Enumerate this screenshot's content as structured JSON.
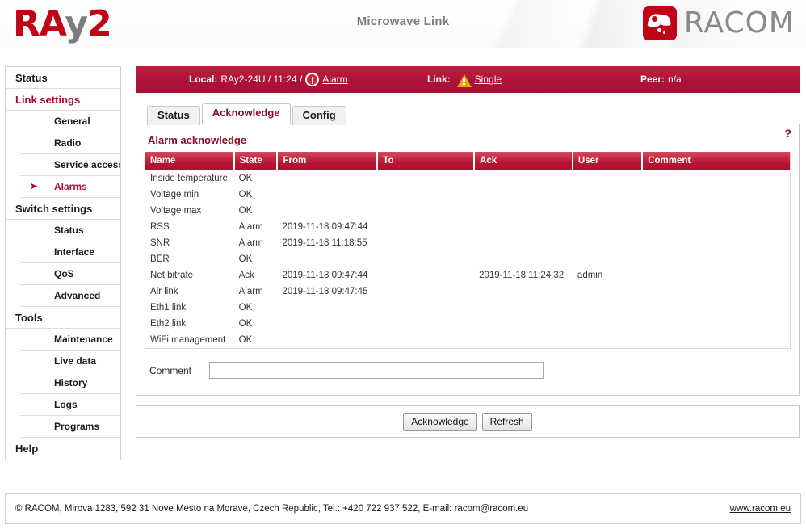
{
  "header": {
    "logo_text_red_1": "RA",
    "logo_text_grey": "y",
    "logo_text_red_2": "2",
    "title": "Microwave Link",
    "brand": "RACOM"
  },
  "statusbar": {
    "local_label": "Local:",
    "local_value": "RAy2-24U / 11:24 /",
    "local_alarm_link": "Alarm",
    "link_label": "Link:",
    "link_value": "Single",
    "peer_label": "Peer:",
    "peer_value": "n/a"
  },
  "sidebar": {
    "items": [
      {
        "label": "Status",
        "type": "group",
        "state": "normal"
      },
      {
        "label": "Link settings",
        "type": "group",
        "state": "active"
      },
      {
        "label": "General",
        "type": "sub",
        "state": "normal"
      },
      {
        "label": "Radio",
        "type": "sub",
        "state": "normal"
      },
      {
        "label": "Service access",
        "type": "sub",
        "state": "normal"
      },
      {
        "label": "Alarms",
        "type": "sub",
        "state": "current"
      },
      {
        "label": "Switch settings",
        "type": "group",
        "state": "normal"
      },
      {
        "label": "Status",
        "type": "sub",
        "state": "normal"
      },
      {
        "label": "Interface",
        "type": "sub",
        "state": "normal"
      },
      {
        "label": "QoS",
        "type": "sub",
        "state": "normal"
      },
      {
        "label": "Advanced",
        "type": "sub",
        "state": "normal"
      },
      {
        "label": "Tools",
        "type": "group",
        "state": "normal"
      },
      {
        "label": "Maintenance",
        "type": "sub",
        "state": "normal"
      },
      {
        "label": "Live data",
        "type": "sub",
        "state": "normal"
      },
      {
        "label": "History",
        "type": "sub",
        "state": "normal"
      },
      {
        "label": "Logs",
        "type": "sub",
        "state": "normal"
      },
      {
        "label": "Programs",
        "type": "sub",
        "state": "normal"
      },
      {
        "label": "Help",
        "type": "group",
        "state": "normal"
      }
    ]
  },
  "tabs": [
    {
      "label": "Status",
      "active": false
    },
    {
      "label": "Acknowledge",
      "active": true
    },
    {
      "label": "Config",
      "active": false
    }
  ],
  "panel": {
    "title": "Alarm acknowledge",
    "help_glyph": "?"
  },
  "table": {
    "columns": [
      "Name",
      "State",
      "From",
      "To",
      "Ack",
      "User",
      "Comment"
    ],
    "rows": [
      {
        "name": "Inside temperature",
        "state": "OK",
        "from": "",
        "to": "",
        "ack": "",
        "user": "",
        "comment": ""
      },
      {
        "name": "Voltage min",
        "state": "OK",
        "from": "",
        "to": "",
        "ack": "",
        "user": "",
        "comment": ""
      },
      {
        "name": "Voltage max",
        "state": "OK",
        "from": "",
        "to": "",
        "ack": "",
        "user": "",
        "comment": ""
      },
      {
        "name": "RSS",
        "state": "Alarm",
        "from": "2019-11-18 09:47:44",
        "to": "",
        "ack": "",
        "user": "",
        "comment": ""
      },
      {
        "name": "SNR",
        "state": "Alarm",
        "from": "2019-11-18 11:18:55",
        "to": "",
        "ack": "",
        "user": "",
        "comment": ""
      },
      {
        "name": "BER",
        "state": "OK",
        "from": "",
        "to": "",
        "ack": "",
        "user": "",
        "comment": ""
      },
      {
        "name": "Net bitrate",
        "state": "Ack",
        "from": "2019-11-18 09:47:44",
        "to": "",
        "ack": "2019-11-18 11:24:32",
        "user": "admin",
        "comment": ""
      },
      {
        "name": "Air link",
        "state": "Alarm",
        "from": "2019-11-18 09:47:45",
        "to": "",
        "ack": "",
        "user": "",
        "comment": ""
      },
      {
        "name": "Eth1 link",
        "state": "OK",
        "from": "",
        "to": "",
        "ack": "",
        "user": "",
        "comment": ""
      },
      {
        "name": "Eth2 link",
        "state": "OK",
        "from": "",
        "to": "",
        "ack": "",
        "user": "",
        "comment": ""
      },
      {
        "name": "WiFi management",
        "state": "OK",
        "from": "",
        "to": "",
        "ack": "",
        "user": "",
        "comment": ""
      }
    ]
  },
  "comment_field": {
    "label": "Comment",
    "value": "",
    "placeholder": ""
  },
  "buttons": {
    "acknowledge": "Acknowledge",
    "refresh": "Refresh"
  },
  "footer": {
    "text": "© RACOM, Mirova 1283, 592 31 Nove Mesto na Morave, Czech Republic, Tel.: +420 722 937 522, E-mail: racom@racom.eu",
    "link": "www.racom.eu"
  },
  "colors": {
    "brand_red": "#c00418",
    "accent_dark_red": "#8c0a26",
    "statusbar_red": "#b3153a",
    "warning_amber": "#eda60d"
  }
}
